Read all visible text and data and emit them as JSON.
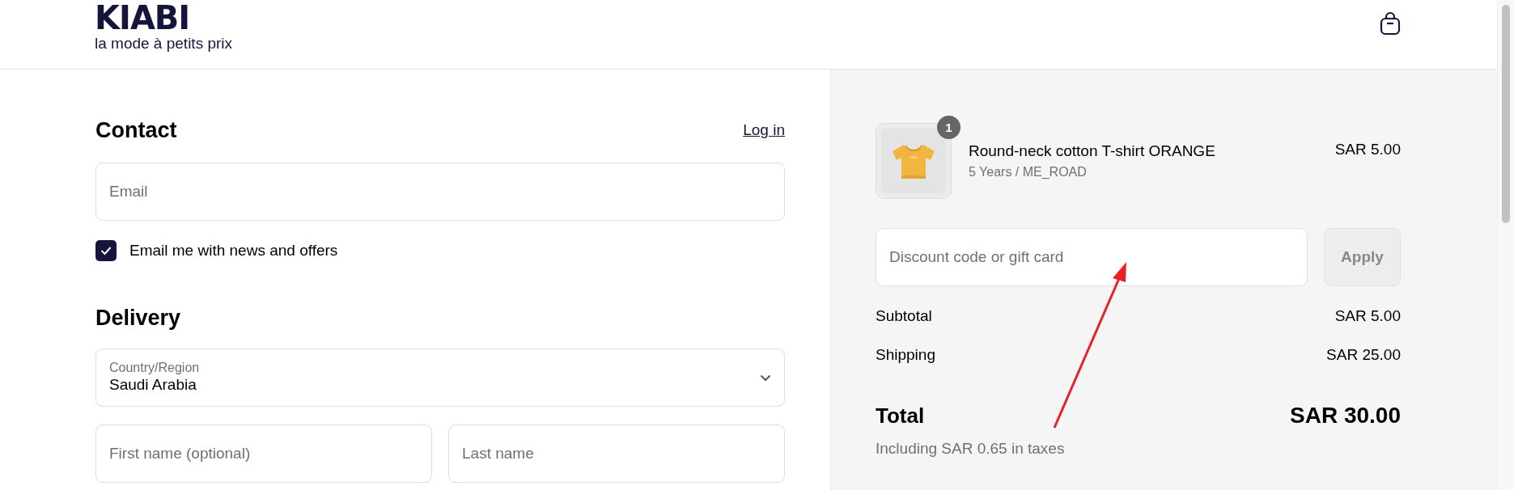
{
  "header": {
    "logo": "KIABI",
    "tagline": "la mode à petits prix"
  },
  "contact": {
    "heading": "Contact",
    "login_link": "Log in",
    "email": {
      "placeholder": "Email"
    },
    "newsletter": {
      "label": "Email me with news and offers",
      "checked": true
    }
  },
  "delivery": {
    "heading": "Delivery",
    "country": {
      "label": "Country/Region",
      "value": "Saudi Arabia"
    },
    "first_name": {
      "placeholder": "First name (optional)"
    },
    "last_name": {
      "placeholder": "Last name"
    }
  },
  "summary": {
    "items": [
      {
        "name": "Round-neck cotton T-shirt ORANGE",
        "variant": "5 Years / ME_ROAD",
        "price": "SAR 5.00",
        "quantity": "1"
      }
    ],
    "discount": {
      "placeholder": "Discount code or gift card",
      "button": "Apply",
      "disabled": true
    },
    "lines": [
      {
        "label": "Subtotal",
        "value": "SAR 5.00"
      },
      {
        "label": "Shipping",
        "value": "SAR 25.00"
      }
    ],
    "total": {
      "label": "Total",
      "value": "SAR 30.00",
      "taxes": "Including SAR 0.65 in taxes"
    }
  },
  "annotations": [
    {
      "kind": "arrow"
    }
  ]
}
